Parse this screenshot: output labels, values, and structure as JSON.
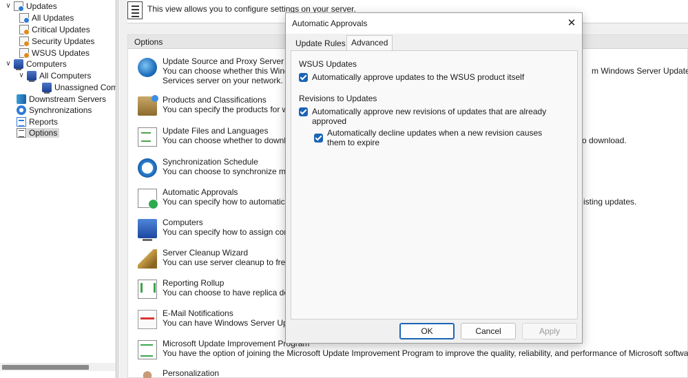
{
  "tree": {
    "items": [
      {
        "label": "Updates",
        "icon": "updates-icon"
      },
      {
        "label": "All Updates",
        "icon": "document-icon"
      },
      {
        "label": "Critical Updates",
        "icon": "document-icon"
      },
      {
        "label": "Security Updates",
        "icon": "document-icon"
      },
      {
        "label": "WSUS Updates",
        "icon": "document-icon"
      },
      {
        "label": "Computers",
        "icon": "computers-icon"
      },
      {
        "label": "All Computers",
        "icon": "computers-icon"
      },
      {
        "label": "Unassigned Comp",
        "icon": "computers-icon"
      },
      {
        "label": "Downstream Servers",
        "icon": "server-icon"
      },
      {
        "label": "Synchronizations",
        "icon": "sync-icon"
      },
      {
        "label": "Reports",
        "icon": "reports-icon"
      },
      {
        "label": "Options",
        "icon": "options-icon"
      }
    ]
  },
  "main": {
    "info_text": "This view allows you to configure settings on your server.",
    "options_title": "Options",
    "options": [
      {
        "title": "Update Source and Proxy Server",
        "desc": "You can choose whether this Windo",
        "desc2": "Services server on your network.",
        "tail": "m Windows Server Update",
        "icon": "globe-icon"
      },
      {
        "title": "Products and Classifications",
        "desc": "You can specify the products for whi",
        "tail": "",
        "icon": "products-icon"
      },
      {
        "title": "Update Files and Languages",
        "desc": "You can choose whether to downloa",
        "tail": "o download.",
        "icon": "files-icon"
      },
      {
        "title": "Synchronization Schedule",
        "desc": "You can choose to synchronize manu",
        "tail": "",
        "icon": "schedule-icon"
      },
      {
        "title": "Automatic Approvals",
        "desc": "You can specify how to automatically",
        "tail": "isting updates.",
        "icon": "approvals-icon"
      },
      {
        "title": "Computers",
        "desc": "You can specify how to assign comp",
        "tail": "",
        "icon": "computers-icon"
      },
      {
        "title": "Server Cleanup Wizard",
        "desc": "You can use server cleanup to free u",
        "tail": "",
        "icon": "cleanup-icon"
      },
      {
        "title": "Reporting Rollup",
        "desc": "You can choose to have replica dowr",
        "tail": "",
        "icon": "rollup-icon"
      },
      {
        "title": "E-Mail Notifications",
        "desc": "You can have Windows Server Updat",
        "tail": "",
        "icon": "email-icon"
      },
      {
        "title": "Microsoft Update Improvement Program",
        "desc": "You have the option of joining the Microsoft Update Improvement Program to improve the quality, reliability, and performance of Microsoft software.",
        "tail": "",
        "icon": "improvement-icon"
      },
      {
        "title": "Personalization",
        "desc": "",
        "tail": "",
        "icon": "personalization-icon"
      }
    ]
  },
  "dialog": {
    "title": "Automatic Approvals",
    "tabs": [
      "Update Rules",
      "Advanced"
    ],
    "active_tab": "Advanced",
    "wsus_heading": "WSUS Updates",
    "wsus_checkbox": "Automatically approve updates to the WSUS product itself",
    "revisions_heading": "Revisions to Updates",
    "revisions_checkbox": "Automatically approve new revisions of updates that are already approved",
    "decline_checkbox": "Automatically decline updates when a new revision causes them to expire",
    "buttons": {
      "ok": "OK",
      "cancel": "Cancel",
      "apply": "Apply"
    }
  }
}
